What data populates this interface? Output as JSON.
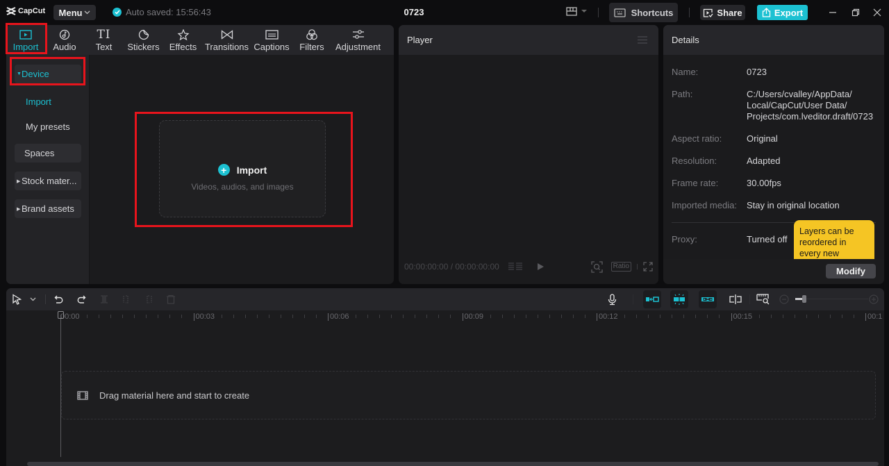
{
  "app": {
    "logo_text": "CapCut",
    "menu_label": "Menu",
    "autosave_text": "Auto saved: 15:56:43",
    "project_title": "0723",
    "shortcuts_label": "Shortcuts",
    "share_label": "Share",
    "export_label": "Export",
    "accent_color": "#1cc1d2"
  },
  "media": {
    "tabs": [
      {
        "label": "Import",
        "icon": "import-icon",
        "active": true
      },
      {
        "label": "Audio",
        "icon": "audio-icon"
      },
      {
        "label": "Text",
        "icon": "text-icon"
      },
      {
        "label": "Stickers",
        "icon": "stickers-icon"
      },
      {
        "label": "Effects",
        "icon": "effects-icon"
      },
      {
        "label": "Transitions",
        "icon": "transitions-icon"
      },
      {
        "label": "Captions",
        "icon": "captions-icon"
      },
      {
        "label": "Filters",
        "icon": "filters-icon"
      },
      {
        "label": "Adjustment",
        "icon": "adjustment-icon"
      }
    ],
    "sidebar": {
      "device": "Device",
      "import": "Import",
      "my_presets": "My presets",
      "spaces": "Spaces",
      "stock": "Stock mater...",
      "brand": "Brand assets"
    },
    "import_card": {
      "title": "Import",
      "subtitle": "Videos, audios, and images"
    }
  },
  "player": {
    "title": "Player",
    "timecode": "00:00:00:00 / 00:00:00:00",
    "ratio_label": "Ratio"
  },
  "details": {
    "title": "Details",
    "rows": [
      {
        "label": "Name:",
        "value": "0723"
      },
      {
        "label": "Path:",
        "value": "C:/Users/cvalley/AppData/\nLocal/CapCut/User Data/\nProjects/com.lveditor.draft/0723"
      },
      {
        "label": "Aspect ratio:",
        "value": "Original"
      },
      {
        "label": "Resolution:",
        "value": "Adapted"
      },
      {
        "label": "Frame rate:",
        "value": "30.00fps"
      },
      {
        "label": "Imported media:",
        "value": "Stay in original location"
      },
      {
        "label": "Proxy:",
        "value": "Turned off"
      }
    ],
    "tooltip": "Layers can be reordered in every new",
    "modify_label": "Modify"
  },
  "timeline": {
    "ruler_labels": [
      "00:00",
      "00:03",
      "00:06",
      "00:09",
      "00:12",
      "00:15",
      "00:1"
    ],
    "drop_text": "Drag material here and start to create"
  }
}
